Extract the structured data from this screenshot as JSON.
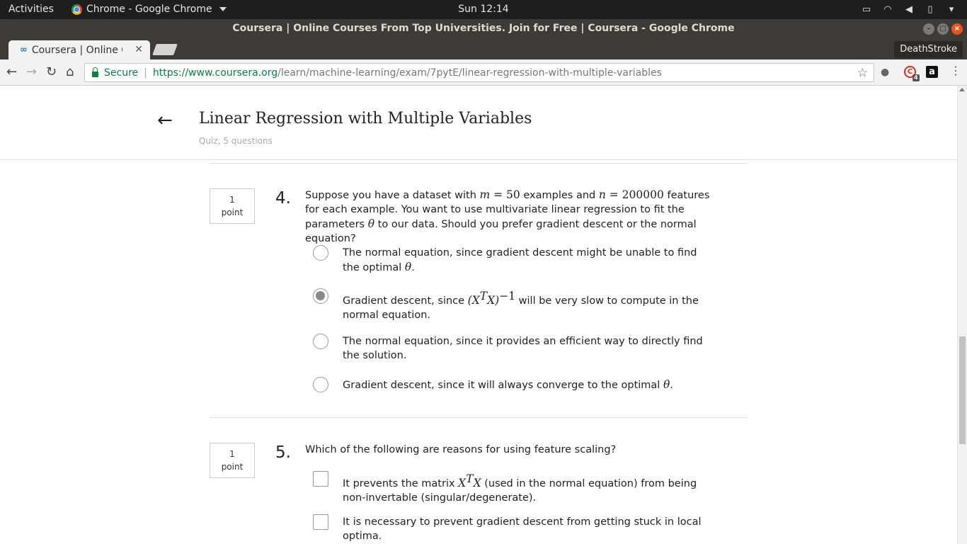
{
  "topbar": {
    "activities": "Activities",
    "app": "Chrome - Google Chrome",
    "clock": "Sun 12:14"
  },
  "window": {
    "title": "Coursera | Online Courses From Top Universities. Join for Free | Coursera - Google Chrome"
  },
  "tabs": [
    {
      "label": "Coursera | Online Courses From Top Universities"
    }
  ],
  "profile": "DeathStroke",
  "omnibox": {
    "secure": "Secure",
    "url_scheme_host": "https://www.coursera.org",
    "url_path": "/learn/machine-learning/exam/7pytE/linear-regression-with-multiple-variables"
  },
  "extensions": {
    "badge_count": "4",
    "amazon": "a"
  },
  "quiz": {
    "title": "Linear Regression with Multiple Variables",
    "subtitle": "Quiz, 5 questions"
  },
  "q4": {
    "points_value": "1",
    "points_label": "point",
    "number": "4.",
    "text_a": "Suppose you have a dataset with ",
    "m_var": "m",
    "m_eq": " = 50",
    "text_b": " examples and ",
    "n_var": "n",
    "n_eq": " = 200000",
    "text_c": " features for each example. You want to use multivariate linear regression to fit the parameters ",
    "theta": "θ",
    "text_d": " to our data. Should you prefer gradient descent or the normal equation?",
    "options": [
      {
        "text": "The normal equation, since gradient descent might be unable to find the optimal ",
        "suffix": ".",
        "selected": false
      },
      {
        "text": "Gradient descent, since ",
        "math": "(X",
        "math_sup": "T",
        "math_mid": "X)",
        "math_sup2": "−1",
        "suffix": " will be very slow to compute in the normal equation.",
        "selected": true
      },
      {
        "text": "The normal equation, since it provides an efficient way to directly find the solution.",
        "selected": false
      },
      {
        "text": "Gradient descent, since it will always converge to the optimal ",
        "suffix": ".",
        "selected": false
      }
    ]
  },
  "q5": {
    "points_value": "1",
    "points_label": "point",
    "number": "5.",
    "text": "Which of the following are reasons for using feature scaling?",
    "options": [
      {
        "text_a": "It prevents the matrix ",
        "math": "X",
        "math_sup": "T",
        "math_end": "X",
        "text_b": " (used in the normal equation) from being non-invertable (singular/degenerate).",
        "checked": false
      },
      {
        "text": "It is necessary to prevent gradient descent from getting stuck in local optima.",
        "checked": false
      }
    ]
  }
}
